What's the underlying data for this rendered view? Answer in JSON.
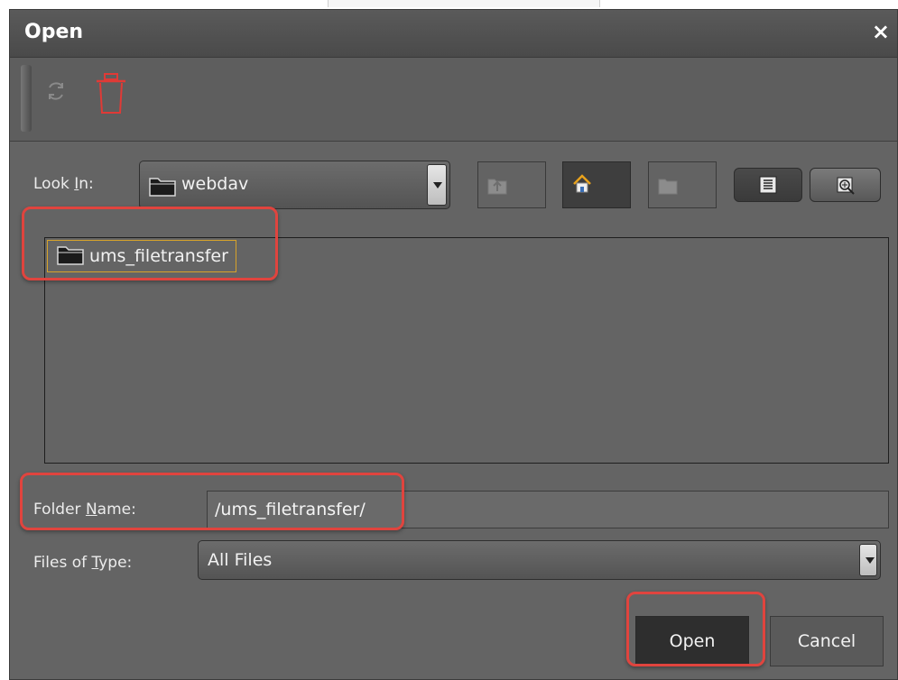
{
  "dialog": {
    "title": "Open",
    "close_glyph": "×"
  },
  "toolbar": {
    "refresh_icon": "refresh-icon",
    "delete_icon": "trash-icon"
  },
  "look_in": {
    "label_pre": "Look ",
    "label_mnemonic": "I",
    "label_post": "n:",
    "value": "webdav"
  },
  "nav_buttons": [
    "up-folder-icon",
    "home-icon",
    "new-folder-icon"
  ],
  "view_buttons": [
    "list-view-icon",
    "details-view-icon"
  ],
  "file_list": {
    "items": [
      {
        "name": "ums_filetransfer",
        "icon": "folder-icon",
        "selected": true
      }
    ]
  },
  "folder_name": {
    "label_pre": "Folder ",
    "label_mnemonic": "N",
    "label_post": "ame:",
    "value": "/ums_filetransfer/"
  },
  "files_of_type": {
    "label_pre": "Files of ",
    "label_mnemonic": "T",
    "label_post": "ype:",
    "value": "All Files"
  },
  "buttons": {
    "open_label": "Open",
    "cancel_label": "Cancel"
  },
  "colors": {
    "dialog_bg": "#646464",
    "highlight_red": "#e0443e",
    "selection_border": "#d7a32a",
    "trash_red": "#e03a36"
  }
}
